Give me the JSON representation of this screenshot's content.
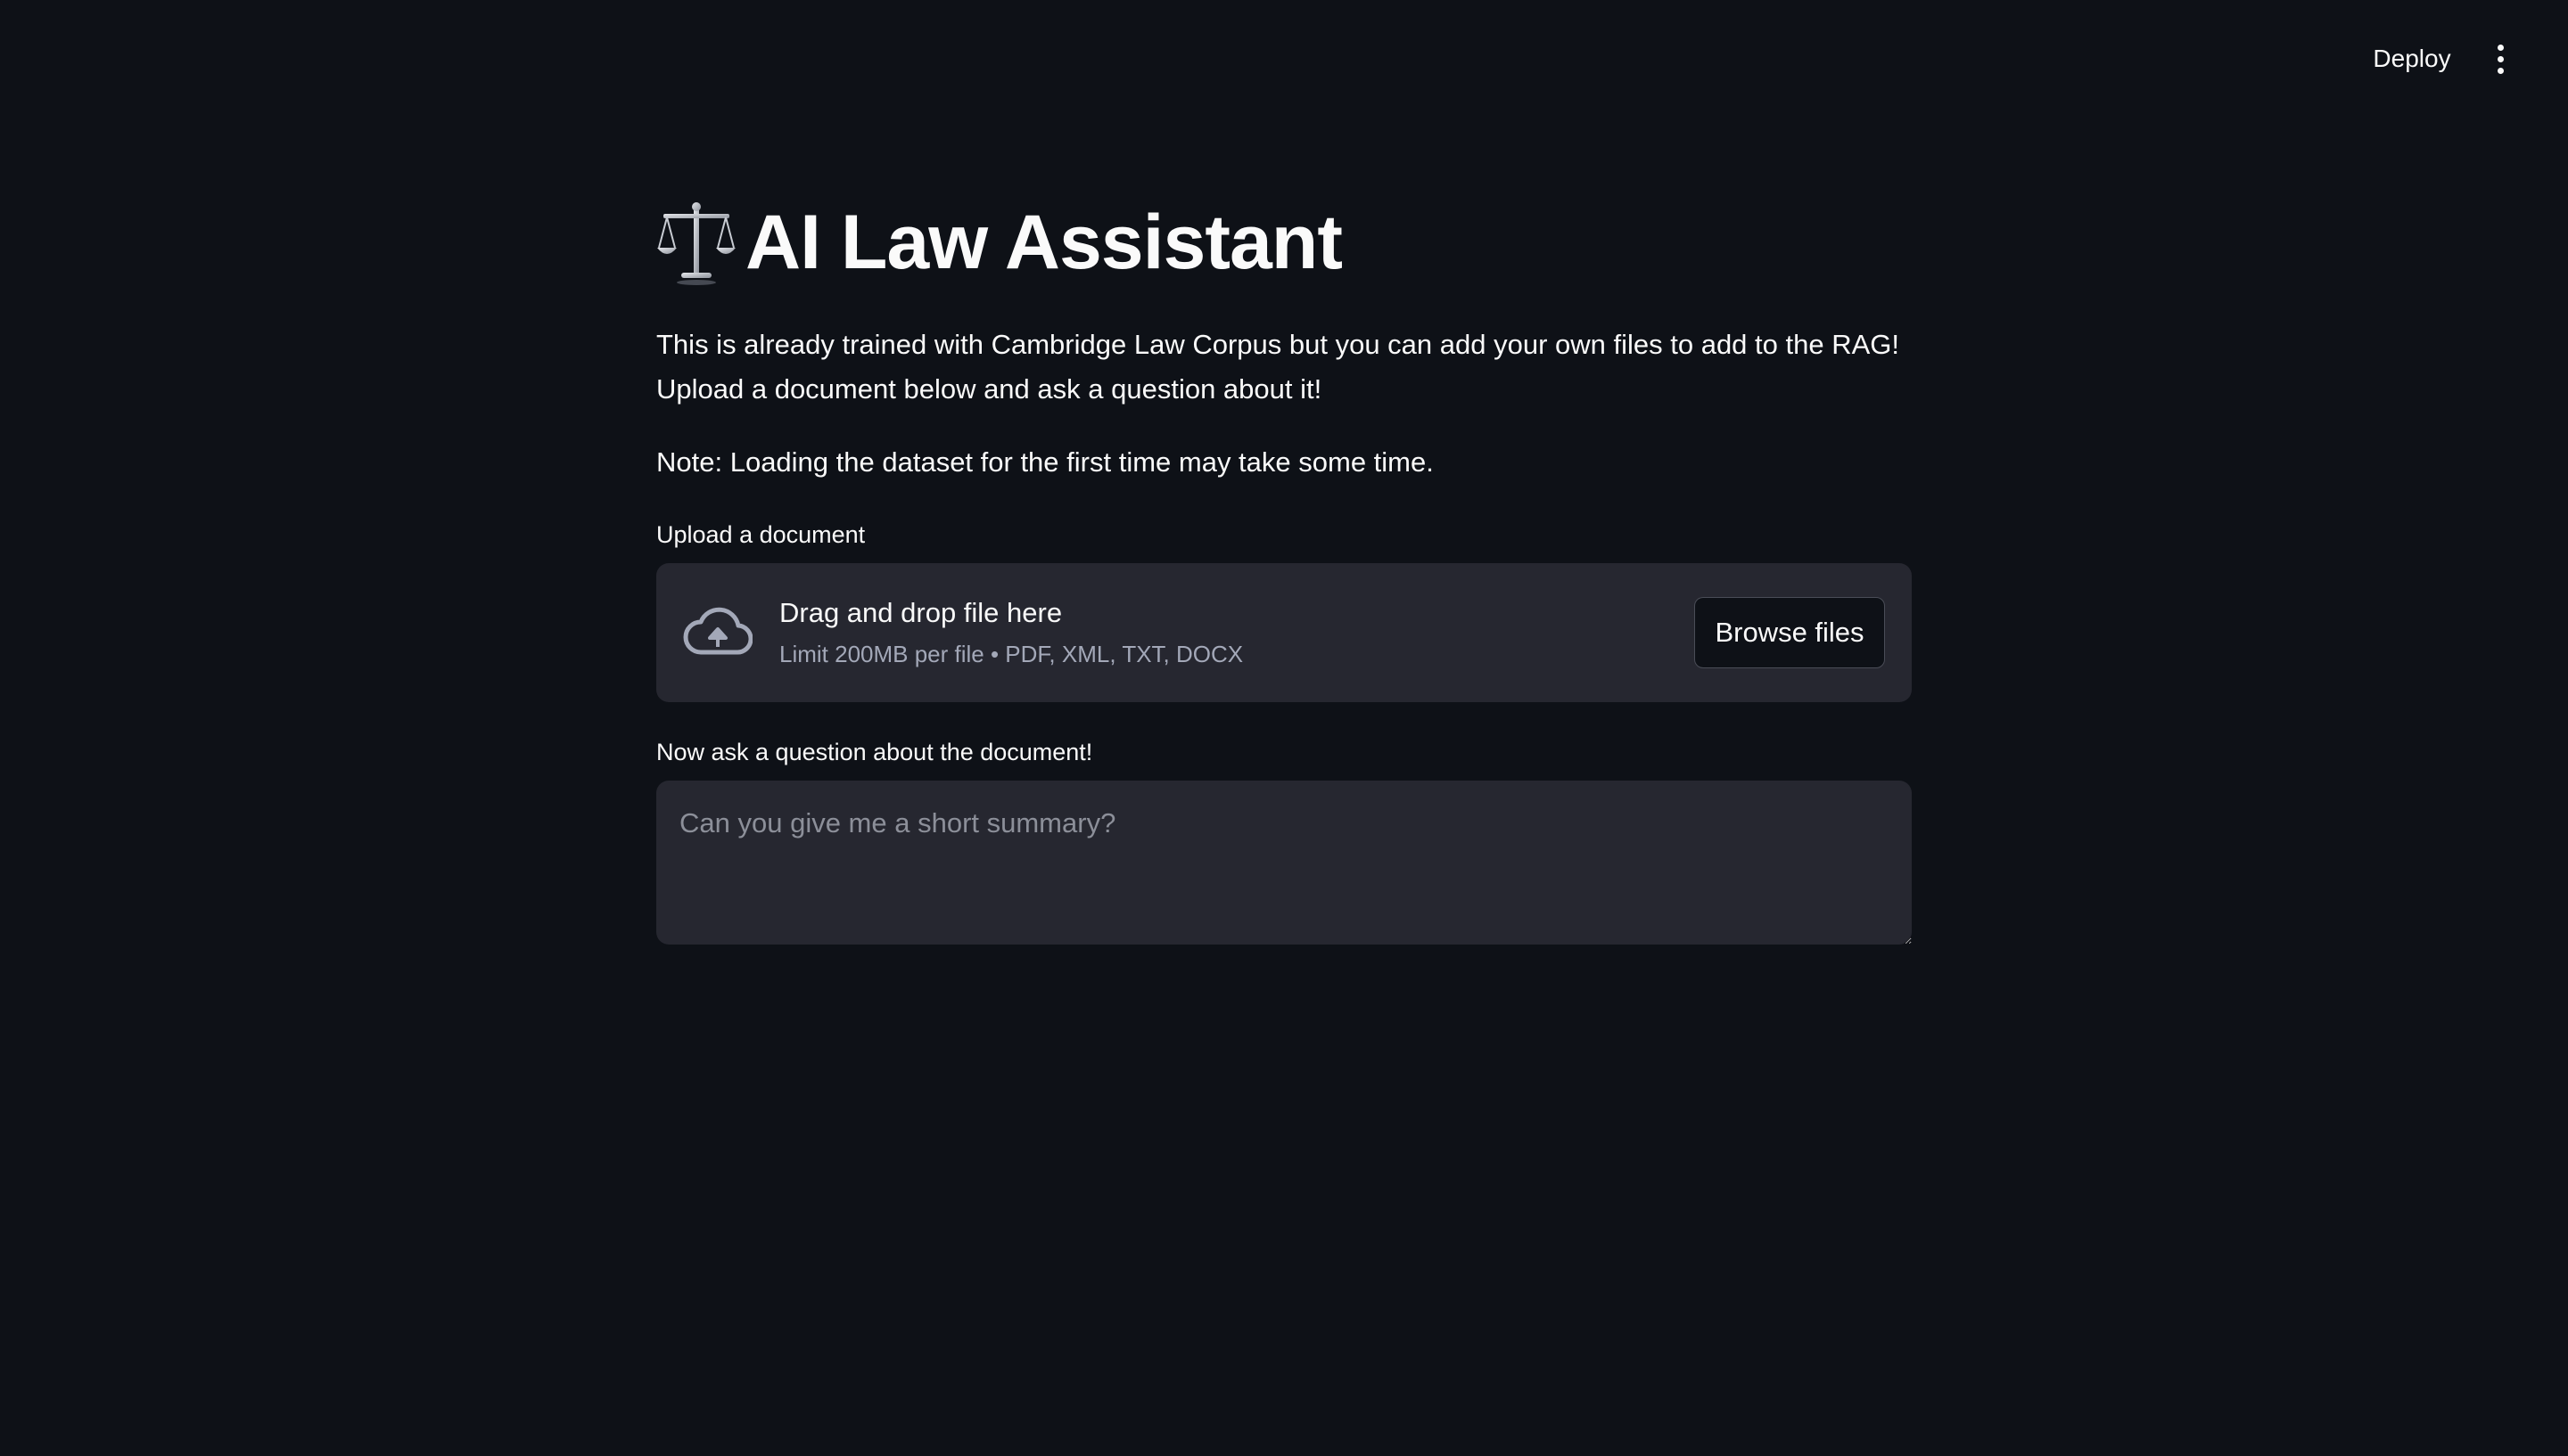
{
  "header": {
    "deploy_label": "Deploy",
    "menu_icon": "vertical-dots-icon"
  },
  "main": {
    "title_icon": "balance-scale-icon",
    "title": "AI Law Assistant",
    "intro_line1": "This is already trained with Cambridge Law Corpus but you can add your own files to add to the RAG!",
    "intro_line2": "Upload a document below and ask a question about it!",
    "note": "Note: Loading the dataset for the first time may take some time."
  },
  "uploader": {
    "label": "Upload a document",
    "icon": "cloud-upload-icon",
    "dropzone_title": "Drag and drop file here",
    "dropzone_limit": "Limit 200MB per file • PDF, XML, TXT, DOCX",
    "browse_label": "Browse files"
  },
  "question": {
    "label": "Now ask a question about the document!",
    "placeholder": "Can you give me a short summary?",
    "value": ""
  },
  "colors": {
    "background": "#0e1117",
    "panel": "#262730",
    "text": "#fafafa",
    "muted": "#a3a8b8"
  }
}
